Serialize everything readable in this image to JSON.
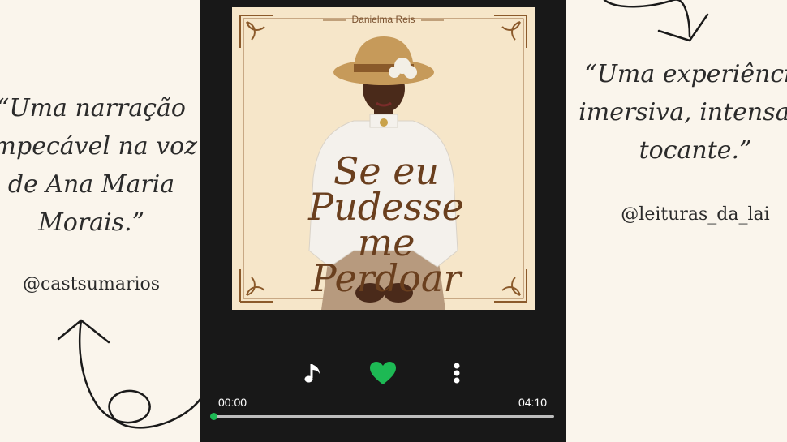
{
  "quote_left": {
    "lines": [
      "“Uma narração",
      "impecável na voz",
      "de Ana Maria",
      "Morais.”"
    ],
    "handle": "@castsumarios"
  },
  "quote_right": {
    "lines": [
      "“Uma experiência",
      "imersiva, intensa e",
      "tocante.”"
    ],
    "handle": "@leituras_da_lai"
  },
  "player": {
    "cover": {
      "author": "Danielma Reis",
      "title_lines": [
        "Se eu",
        "Pudesse",
        "me",
        "Perdoar"
      ]
    },
    "icons": {
      "music_note": "music-note-icon",
      "heart": "heart-icon",
      "more": "more-vertical-icon"
    },
    "time_elapsed": "00:00",
    "time_total": "04:10",
    "progress_fraction": 0.0,
    "colors": {
      "accent": "#1db954",
      "background": "#181818"
    }
  }
}
